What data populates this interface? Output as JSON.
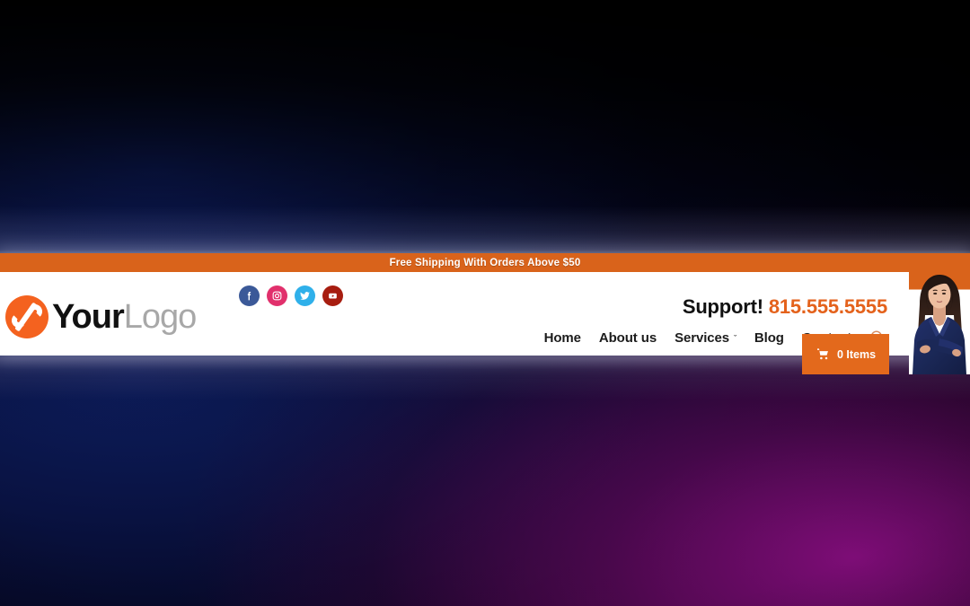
{
  "announcement": {
    "text": "Free Shipping With Orders Above $50",
    "bg_color": "#d9631b",
    "text_color": "#ffffff"
  },
  "brand": {
    "name_bold": "Your",
    "name_light": "Logo",
    "mark_icon": "swirl-logo-icon",
    "mark_color": "#f4621f",
    "bold_color": "#111111",
    "light_color": "#a8a8a8"
  },
  "social": [
    {
      "name": "facebook",
      "icon": "facebook-icon",
      "color": "#3b5998",
      "glyph": "f"
    },
    {
      "name": "instagram",
      "icon": "instagram-icon",
      "color": "#e1306c",
      "glyph": "camera"
    },
    {
      "name": "twitter",
      "icon": "twitter-icon",
      "color": "#2fb0ea",
      "glyph": "bird"
    },
    {
      "name": "youtube",
      "icon": "youtube-icon",
      "color": "#a71d10",
      "glyph": "play"
    }
  ],
  "support": {
    "label": "Support!",
    "phone": "815.555.5555",
    "label_color": "#111111",
    "phone_color": "#e4621c"
  },
  "nav": {
    "items": [
      {
        "label": "Home",
        "has_dropdown": false
      },
      {
        "label": "About us",
        "has_dropdown": false
      },
      {
        "label": "Services",
        "has_dropdown": true,
        "chevron": "ˇ"
      },
      {
        "label": "Blog",
        "has_dropdown": false
      },
      {
        "label": "Contact",
        "has_dropdown": false
      }
    ],
    "search_icon": "search-icon",
    "search_color": "#d98b5e",
    "text_color": "#1c1c1c"
  },
  "cart": {
    "label": "0 Items",
    "icon": "shopping-cart-icon",
    "bg_color": "#e3691c",
    "text_color": "#ffffff"
  },
  "hero_photo": {
    "alt": "businesswoman-photo",
    "description": "Businesswoman with dark hair wearing a navy blazer and white shirt, arms crossed"
  },
  "background": {
    "left_color": "#0d1d5c",
    "mid_color": "#000000",
    "right_color": "#860e7e"
  }
}
